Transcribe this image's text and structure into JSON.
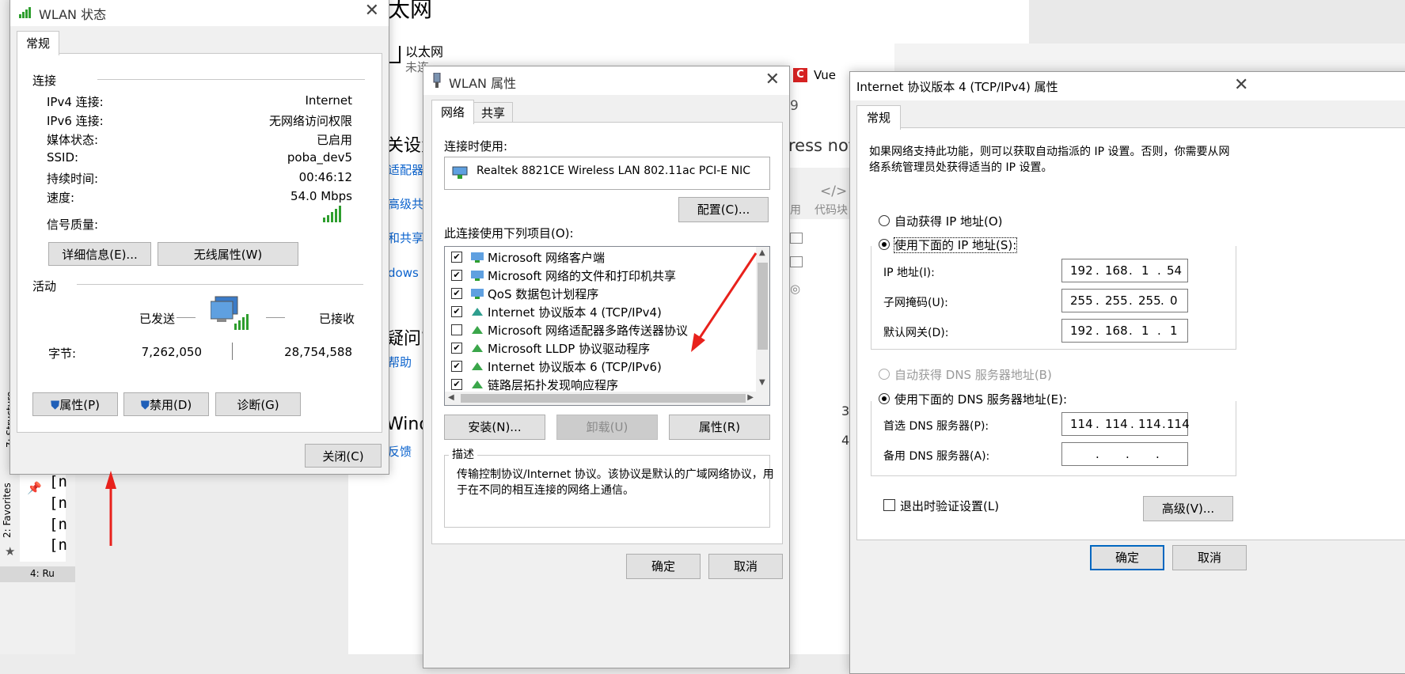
{
  "background": {
    "ethernet_title": "太网",
    "ethernet_label": "以太网",
    "ethernet_status": "未连",
    "settings_heading": "关设置",
    "link_adapter": "适配器",
    "link_advanced": "高级共",
    "link_sharing": "和共享",
    "link_windows": "dows 防",
    "question_heading": "疑问?",
    "link_help": "帮助",
    "windows_heading": "Wind",
    "link_feedback": "反馈",
    "browser_tab_vue": "Vue",
    "browser_number": "9",
    "browser_text_ress": "ress not",
    "code_block_label": "代码块",
    "code_block_left": "用",
    "right_num_3": "3",
    "right_num_4": "4",
    "ide_lines": [
      "[n",
      "[n",
      "[n",
      "[n"
    ],
    "ide_favorites": "2: Favorites",
    "ide_structure": "7: Structure",
    "ide_bottom": "4: Ru"
  },
  "wlan_status": {
    "title": "WLAN 状态",
    "tab": "常规",
    "group_connection": "连接",
    "rows": [
      {
        "label": "IPv4 连接:",
        "value": "Internet"
      },
      {
        "label": "IPv6 连接:",
        "value": "无网络访问权限"
      },
      {
        "label": "媒体状态:",
        "value": "已启用"
      },
      {
        "label": "SSID:",
        "value": "poba_dev5"
      },
      {
        "label": "持续时间:",
        "value": "00:46:12"
      },
      {
        "label": "速度:",
        "value": "54.0 Mbps"
      }
    ],
    "signal_label": "信号质量:",
    "details_button": "详细信息(E)...",
    "wireless_props_button": "无线属性(W)",
    "group_activity": "活动",
    "sent_label": "已发送",
    "received_label": "已接收",
    "bytes_label": "字节:",
    "bytes_sent": "7,262,050",
    "bytes_received": "28,754,588",
    "properties_button": "属性(P)",
    "disable_button": "禁用(D)",
    "diagnose_button": "诊断(G)",
    "close_button": "关闭(C)"
  },
  "wlan_props": {
    "title": "WLAN 属性",
    "tab_network": "网络",
    "tab_sharing": "共享",
    "connect_using_label": "连接时使用:",
    "adapter_name": "Realtek 8821CE Wireless LAN 802.11ac PCI-E NIC",
    "configure_button": "配置(C)...",
    "items_label": "此连接使用下列项目(O):",
    "items": [
      {
        "text": "Microsoft 网络客户端",
        "checked": "✔"
      },
      {
        "text": "Microsoft 网络的文件和打印机共享",
        "checked": "✔"
      },
      {
        "text": "QoS 数据包计划程序",
        "checked": "✔"
      },
      {
        "text": "Internet 协议版本 4 (TCP/IPv4)",
        "checked": "✔"
      },
      {
        "text": "Microsoft 网络适配器多路传送器协议",
        "checked": ""
      },
      {
        "text": "Microsoft LLDP 协议驱动程序",
        "checked": "✔"
      },
      {
        "text": "Internet 协议版本 6 (TCP/IPv6)",
        "checked": "✔"
      },
      {
        "text": "链路层拓扑发现响应程序",
        "checked": "✔"
      }
    ],
    "install_button": "安装(N)...",
    "uninstall_button": "卸载(U)",
    "properties_button": "属性(R)",
    "description_label": "描述",
    "description_text_1": "传输控制协议/Internet 协议。该协议是默认的广域网络协议，用",
    "description_text_2": "于在不同的相互连接的网络上通信。",
    "ok_button": "确定",
    "cancel_button": "取消"
  },
  "ipv4_props": {
    "title": "Internet 协议版本 4 (TCP/IPv4) 属性",
    "tab": "常规",
    "intro_1": "如果网络支持此功能，则可以获取自动指派的 IP 设置。否则，你需要从网",
    "intro_2": "络系统管理员处获得适当的 IP 设置。",
    "auto_ip_label": "自动获得 IP 地址(O)",
    "manual_ip_label": "使用下面的 IP 地址(S):",
    "ip_label": "IP 地址(I):",
    "ip_value": [
      "192",
      "168",
      "1",
      "54"
    ],
    "mask_label": "子网掩码(U):",
    "mask_value": [
      "255",
      "255",
      "255",
      "0"
    ],
    "gateway_label": "默认网关(D):",
    "gateway_value": [
      "192",
      "168",
      "1",
      "1"
    ],
    "auto_dns_label": "自动获得 DNS 服务器地址(B)",
    "manual_dns_label": "使用下面的 DNS 服务器地址(E):",
    "preferred_dns_label": "首选 DNS 服务器(P):",
    "preferred_dns_value": [
      "114",
      "114",
      "114",
      "114"
    ],
    "alternate_dns_label": "备用 DNS 服务器(A):",
    "alternate_dns_value": [
      "",
      "",
      "",
      ""
    ],
    "validate_label": "退出时验证设置(L)",
    "advanced_button": "高级(V)...",
    "ok_button": "确定",
    "cancel_button": "取消"
  },
  "colors": {
    "accent": "#0067c0",
    "link": "#0b63ce",
    "arrow": "#e8211c",
    "signal": "#2e9e2e"
  }
}
